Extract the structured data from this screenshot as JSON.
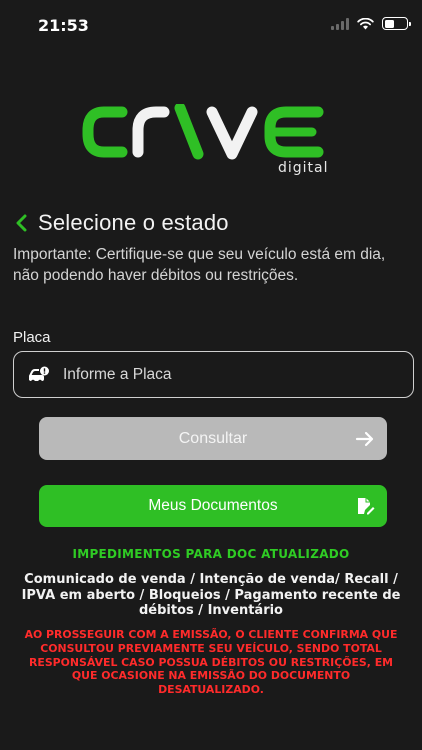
{
  "status_bar": {
    "time": "21:53"
  },
  "logo": {
    "alt": "digital",
    "brand_text": "crlve",
    "colors": {
      "green": "#2fbf25",
      "white": "#f2f2f2"
    }
  },
  "header": {
    "title": "Selecione o estado"
  },
  "notice": {
    "text": "Importante: Certifique-se que seu veículo está em dia, não podendo haver débitos ou restrições."
  },
  "plate": {
    "label": "Placa",
    "placeholder": "Informe a Placa",
    "value": ""
  },
  "buttons": {
    "consult_label": "Consultar",
    "documents_label": "Meus Documentos"
  },
  "impediments": {
    "title": "IMPEDIMENTOS PARA DOC ATUALIZADO",
    "list": "Comunicado de venda / Intenção de venda/ Recall / IPVA em aberto / Bloqueios / Pagamento recente de débitos / Inventário"
  },
  "warning": {
    "text": "AO PROSSEGUIR COM A EMISSÃO, O CLIENTE CONFIRMA QUE CONSULTOU PREVIAMENTE SEU VEÍCULO, SENDO TOTAL RESPONSÁVEL CASO POSSUA DÉBITOS OU RESTRIÇÕES, EM QUE OCASIONE NA EMISSÃO DO DOCUMENTO DESATUALIZADO."
  },
  "colors": {
    "accent": "#2fbf25",
    "background": "#1a1a1a",
    "warning": "#ff2b2b",
    "disabled_button": "#b9b9b9"
  }
}
